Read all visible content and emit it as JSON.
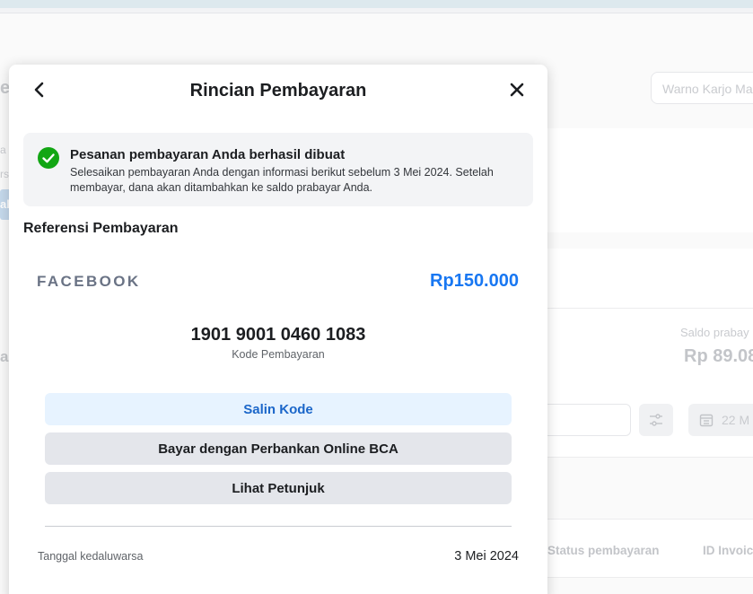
{
  "background": {
    "header_letter": "e",
    "search_placeholder": "Warno Karjo Ma",
    "side_text_1": "a",
    "side_text_2": "rs",
    "side_tab": "ah",
    "side_text_3": "ar",
    "balance_label": "Saldo prabay",
    "balance_value": "Rp 89.08",
    "date_filter": "22 M",
    "col_payment_status": "Status pembayaran",
    "col_invoice_id": "ID Invoice"
  },
  "dialog": {
    "title": "Rincian Pembayaran",
    "success": {
      "title": "Pesanan pembayaran Anda berhasil dibuat",
      "description": "Selesaikan pembayaran Anda dengan informasi berikut sebelum 3 Mei 2024. Setelah membayar, dana akan ditambahkan ke saldo prabayar Anda."
    },
    "section_title": "Referensi Pembayaran",
    "merchant": "FACEBOOK",
    "amount": "Rp150.000",
    "payment_code": "1901 9001 0460 1083",
    "payment_code_label": "Kode Pembayaran",
    "buttons": {
      "copy": "Salin Kode",
      "pay_bca": "Bayar dengan Perbankan Online BCA",
      "instructions": "Lihat Petunjuk"
    },
    "expiry_label": "Tanggal kedaluwarsa",
    "expiry_value": "3 Mei 2024"
  },
  "icons": {
    "back": "chevron-left-icon",
    "close": "close-icon",
    "success": "check-circle-icon",
    "filter": "sliders-icon",
    "calendar": "calendar-icon"
  },
  "colors": {
    "accent": "#1877f2",
    "success_green": "#12a614",
    "copy_button_bg": "#e7f3ff",
    "secondary_button_bg": "#e4e6eb"
  }
}
